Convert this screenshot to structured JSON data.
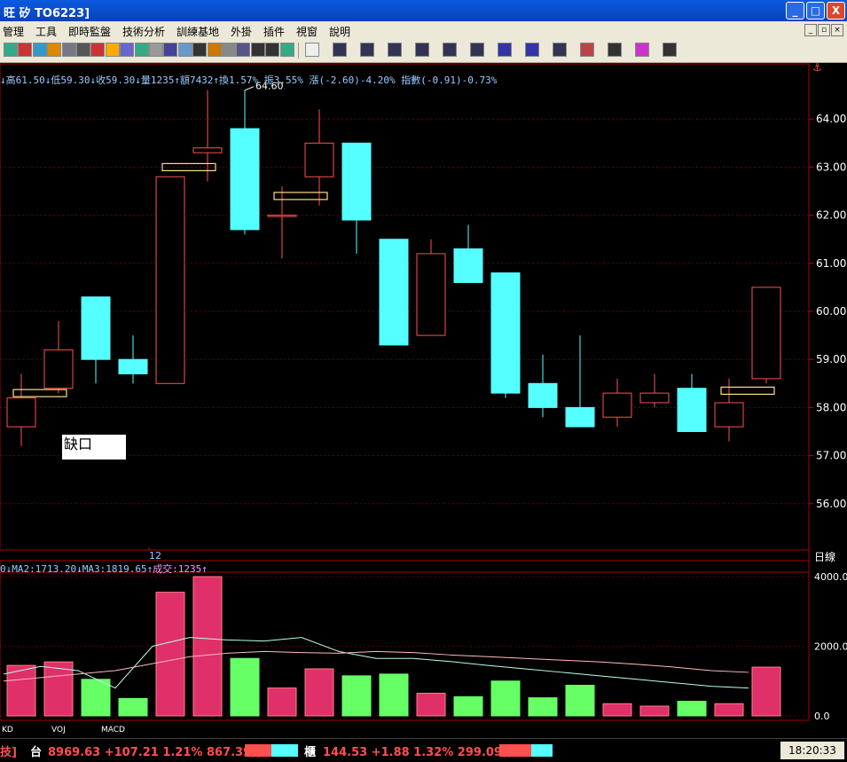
{
  "window": {
    "title": "旺   矽 TO6223]",
    "min_label": "_",
    "max_label": "□",
    "close_label": "X"
  },
  "menu": {
    "items": [
      "管理",
      "工具",
      "即時監盤",
      "技術分析",
      "訓練基地",
      "外掛",
      "插件",
      "視窗",
      "說明"
    ]
  },
  "quote_line": "↓高61.50↓低59.30↓收59.30↓量1235↑額7432↑換1.57% 振3.55% 漲(-2.60)-4.20% 指數(-0.91)-0.73%",
  "volume_line": {
    "prefix": "0↓MA2:1713.20↓MA3:1819.65↑",
    "vol": "成交:1235↑"
  },
  "period_label": "日線",
  "gap_label": "缺口",
  "tabs": [
    "KD",
    "VOJ",
    "MACD"
  ],
  "status": {
    "left": "技]",
    "tai_label": "台",
    "tai_value": "8969.63 +107.21 1.21% 867.39億",
    "otc_label": "櫃",
    "otc_value": "144.53 +1.88 1.32% 299.09億",
    "time": "18:20:33"
  },
  "colors": {
    "up": "#ff5050",
    "down": "#55ffff",
    "vol_up": "#e0306a",
    "vol_down": "#66ff66"
  },
  "chart_data": {
    "type": "candlestick",
    "period": "日線",
    "price_axis": {
      "min": 55.0,
      "max": 65.0,
      "ticks": [
        "56.00",
        "57.00",
        "58.00",
        "59.00",
        "60.00",
        "61.00",
        "62.00",
        "63.00",
        "64.00"
      ]
    },
    "date_ticks": [
      {
        "label": "12",
        "index": 3.5
      }
    ],
    "high_label": "64.60",
    "candles": [
      {
        "open": 57.6,
        "close": 58.2,
        "high": 58.7,
        "low": 57.2
      },
      {
        "open": 58.4,
        "close": 59.2,
        "high": 59.8,
        "low": 58.3
      },
      {
        "open": 60.3,
        "close": 59.0,
        "high": 60.3,
        "low": 58.5
      },
      {
        "open": 59.0,
        "close": 58.7,
        "high": 59.5,
        "low": 58.5
      },
      {
        "open": 58.5,
        "close": 62.8,
        "high": 62.8,
        "low": 58.5
      },
      {
        "open": 63.3,
        "close": 63.4,
        "high": 64.6,
        "low": 62.7
      },
      {
        "open": 63.8,
        "close": 61.7,
        "high": 64.6,
        "low": 61.6
      },
      {
        "open": 62.0,
        "close": 62.0,
        "high": 62.6,
        "low": 61.1
      },
      {
        "open": 62.8,
        "close": 63.5,
        "high": 64.2,
        "low": 62.2
      },
      {
        "open": 63.5,
        "close": 61.9,
        "high": 63.5,
        "low": 61.2
      },
      {
        "open": 61.5,
        "close": 59.3,
        "high": 61.5,
        "low": 59.3
      },
      {
        "open": 59.5,
        "close": 61.2,
        "high": 61.5,
        "low": 59.5
      },
      {
        "open": 61.3,
        "close": 60.6,
        "high": 61.8,
        "low": 60.6
      },
      {
        "open": 60.8,
        "close": 58.3,
        "high": 60.8,
        "low": 58.2
      },
      {
        "open": 58.5,
        "close": 58.0,
        "high": 59.1,
        "low": 57.8
      },
      {
        "open": 58.0,
        "close": 57.6,
        "high": 59.5,
        "low": 57.6
      },
      {
        "open": 57.8,
        "close": 58.3,
        "high": 58.6,
        "low": 57.6
      },
      {
        "open": 58.1,
        "close": 58.3,
        "high": 58.7,
        "low": 58.0
      },
      {
        "open": 58.4,
        "close": 57.5,
        "high": 58.7,
        "low": 57.5
      },
      {
        "open": 57.6,
        "close": 58.1,
        "high": 58.6,
        "low": 57.3
      },
      {
        "open": 58.6,
        "close": 60.5,
        "high": 60.5,
        "low": 58.5
      }
    ],
    "gap_markers": [
      {
        "index": 0.5,
        "price": 58.3
      },
      {
        "index": 4.5,
        "price": 63.0
      },
      {
        "index": 7.5,
        "price": 62.4
      },
      {
        "index": 19.5,
        "price": 58.35
      }
    ],
    "volume_axis": {
      "min": 0,
      "max": 4000,
      "ticks": [
        "0.0",
        "2000.0",
        "4000.0"
      ]
    },
    "volume": [
      1450,
      1550,
      1050,
      500,
      3550,
      4000,
      1650,
      800,
      1350,
      1150,
      1200,
      650,
      550,
      1000,
      520,
      880,
      350,
      280,
      420,
      350,
      1400
    ],
    "ma2": [
      1200,
      1420,
      1300,
      800,
      2000,
      2250,
      2180,
      2150,
      2250,
      1850,
      1650,
      1650,
      1560,
      1450,
      1350,
      1250,
      1150,
      1050,
      950,
      850,
      800
    ],
    "ma3": [
      1000,
      1100,
      1200,
      1300,
      1500,
      1700,
      1800,
      1850,
      1820,
      1800,
      1850,
      1820,
      1750,
      1700,
      1650,
      1600,
      1550,
      1480,
      1400,
      1300,
      1250
    ]
  }
}
